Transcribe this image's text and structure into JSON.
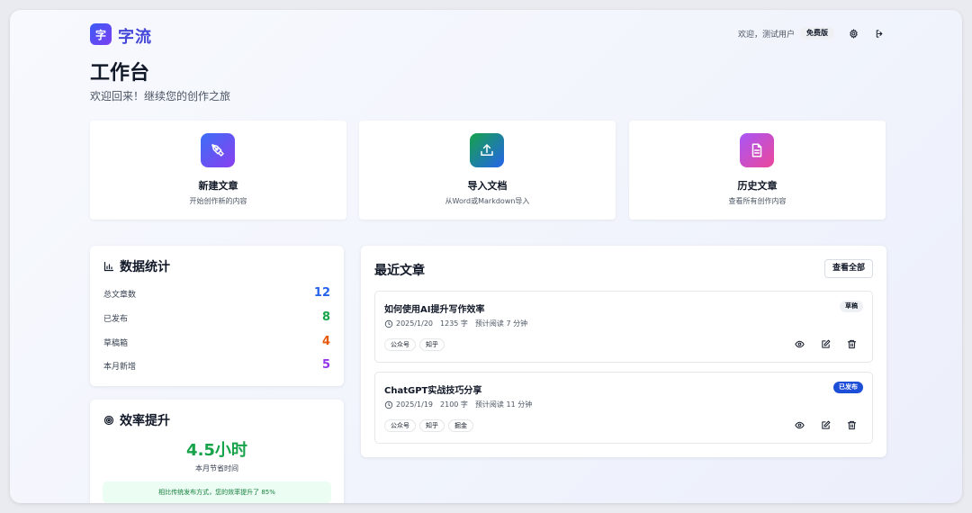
{
  "header": {
    "logo_char": "字",
    "app_name": "字流",
    "welcome": "欢迎，测试用户",
    "plan": "免费版"
  },
  "page": {
    "title": "工作台",
    "subtitle": "欢迎回来！继续您的创作之旅"
  },
  "actions": [
    {
      "title": "新建文章",
      "desc": "开始创作新的内容",
      "icon": "pen-tool-icon",
      "color_from": "#3b6ef6",
      "color_to": "#8b3ff0"
    },
    {
      "title": "导入文档",
      "desc": "从Word或Markdown导入",
      "icon": "upload-icon",
      "color_from": "#16a34a",
      "color_to": "#2563eb"
    },
    {
      "title": "历史文章",
      "desc": "查看所有创作内容",
      "icon": "file-text-icon",
      "color_from": "#a855f7",
      "color_to": "#ec4899"
    }
  ],
  "stats": {
    "title": "数据统计",
    "rows": [
      {
        "label": "总文章数",
        "value": "12",
        "color": "#2563eb"
      },
      {
        "label": "已发布",
        "value": "8",
        "color": "#16a34a"
      },
      {
        "label": "草稿箱",
        "value": "4",
        "color": "#ea580c"
      },
      {
        "label": "本月新增",
        "value": "5",
        "color": "#9333ea"
      }
    ]
  },
  "efficiency": {
    "title": "效率提升",
    "value": "4.5小时",
    "label": "本月节省时间",
    "note": "相比传统发布方式，您的效率提升了 85%"
  },
  "recent": {
    "title": "最近文章",
    "view_all": "查看全部",
    "articles": [
      {
        "title": "如何使用AI提升写作效率",
        "status": "草稿",
        "date": "2025/1/20",
        "words": "1235 字",
        "read": "预计阅读 7 分钟",
        "tags": [
          "公众号",
          "知乎"
        ]
      },
      {
        "title": "ChatGPT实战技巧分享",
        "status": "已发布",
        "date": "2025/1/19",
        "words": "2100 字",
        "read": "预计阅读 11 分钟",
        "tags": [
          "公众号",
          "知乎",
          "掘金"
        ]
      }
    ]
  }
}
